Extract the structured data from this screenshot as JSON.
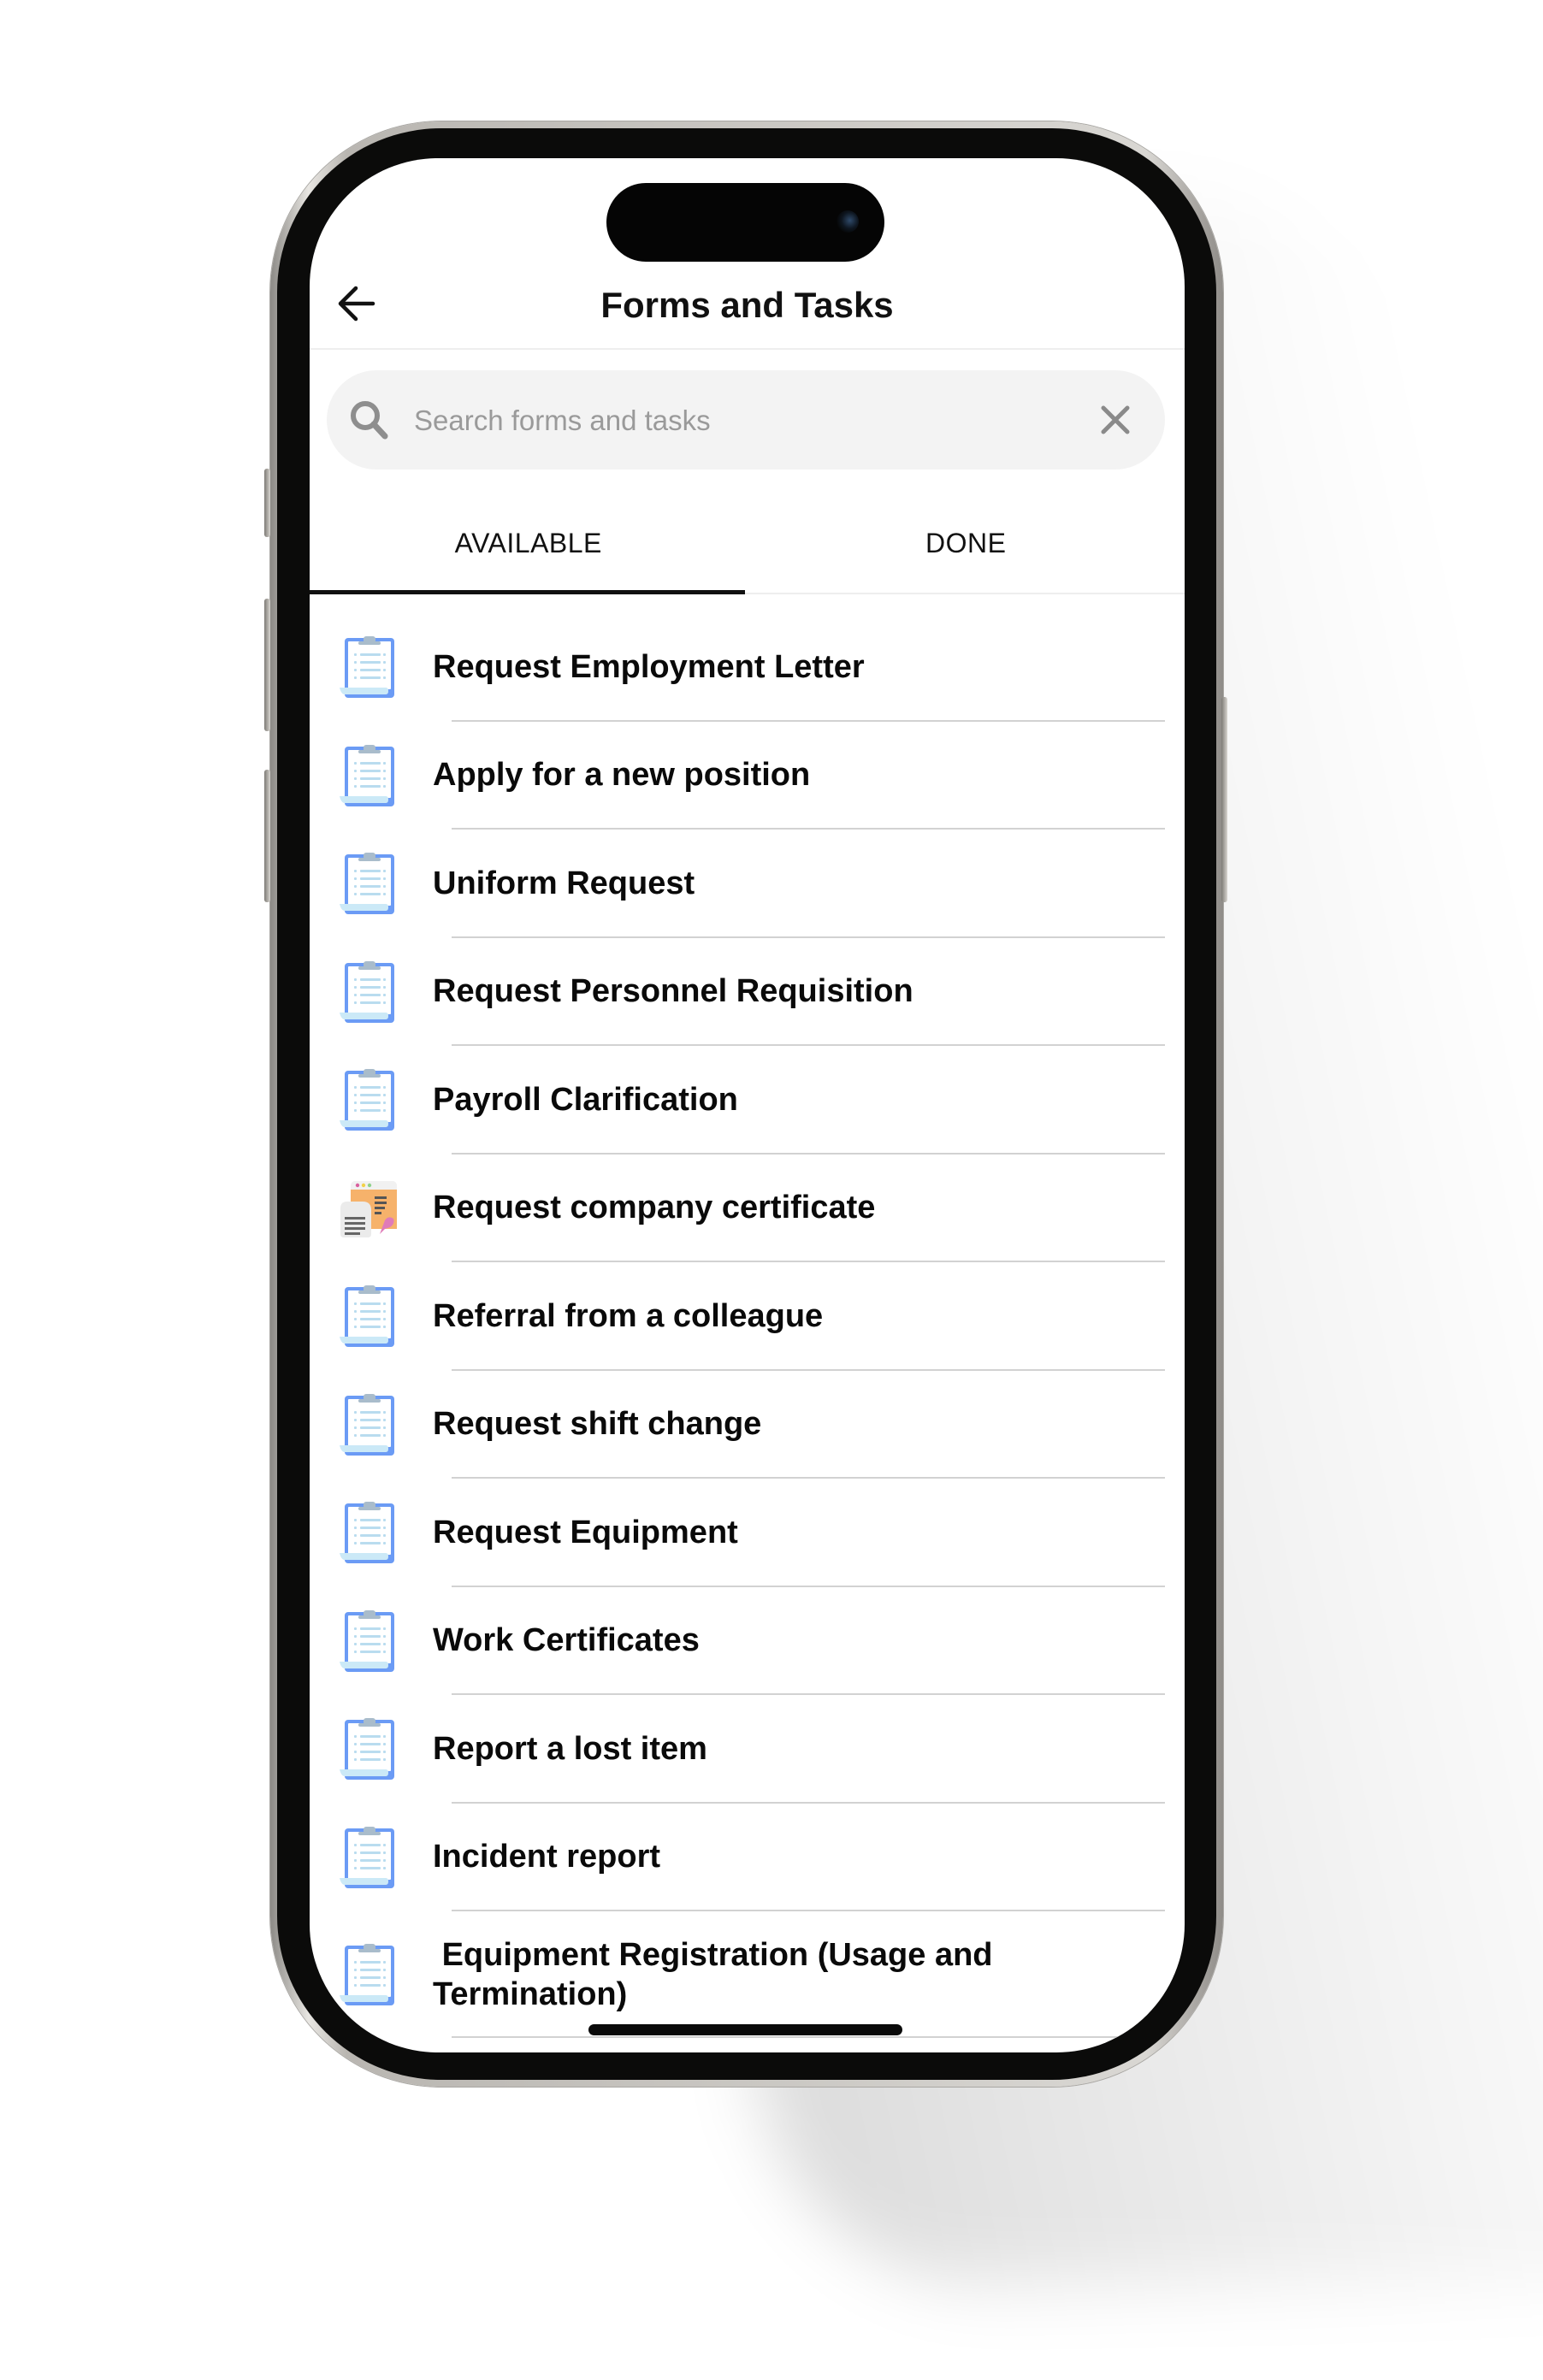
{
  "header": {
    "title": "Forms and Tasks",
    "back_icon": "arrow-left-icon"
  },
  "search": {
    "placeholder": "Search forms and tasks",
    "value": "",
    "search_icon": "search-icon",
    "clear_icon": "close-icon"
  },
  "tabs": [
    {
      "label": "AVAILABLE",
      "active": true
    },
    {
      "label": "DONE",
      "active": false
    }
  ],
  "items": [
    {
      "label": "Request Employment Letter",
      "icon": "clipboard-icon"
    },
    {
      "label": "Apply for a new position",
      "icon": "clipboard-icon"
    },
    {
      "label": "Uniform Request",
      "icon": "clipboard-icon"
    },
    {
      "label": "Request Personnel Requisition",
      "icon": "clipboard-icon"
    },
    {
      "label": "Payroll Clarification",
      "icon": "clipboard-icon"
    },
    {
      "label": "Request company certificate",
      "icon": "certificate-icon"
    },
    {
      "label": "Referral from a colleague",
      "icon": "clipboard-icon"
    },
    {
      "label": "Request shift change",
      "icon": "clipboard-icon"
    },
    {
      "label": "Request Equipment",
      "icon": "clipboard-icon"
    },
    {
      "label": "Work Certificates",
      "icon": "clipboard-icon"
    },
    {
      "label": "Report a lost item",
      "icon": "clipboard-icon"
    },
    {
      "label": "Incident report",
      "icon": "clipboard-icon"
    },
    {
      "label": " Equipment Registration (Usage and Termination)",
      "icon": "clipboard-icon"
    }
  ],
  "colors": {
    "clipboard_board": "#6b9bf5",
    "clipboard_paper": "#ffffff",
    "clipboard_lines": "#b9dcef",
    "clipboard_clip": "#a9bccb",
    "certificate_orange": "#f6b26b",
    "certificate_pink": "#e07bb8",
    "search_bg": "#f3f3f3",
    "separator": "#d2d2d2",
    "active_tab_indicator": "#111111"
  }
}
